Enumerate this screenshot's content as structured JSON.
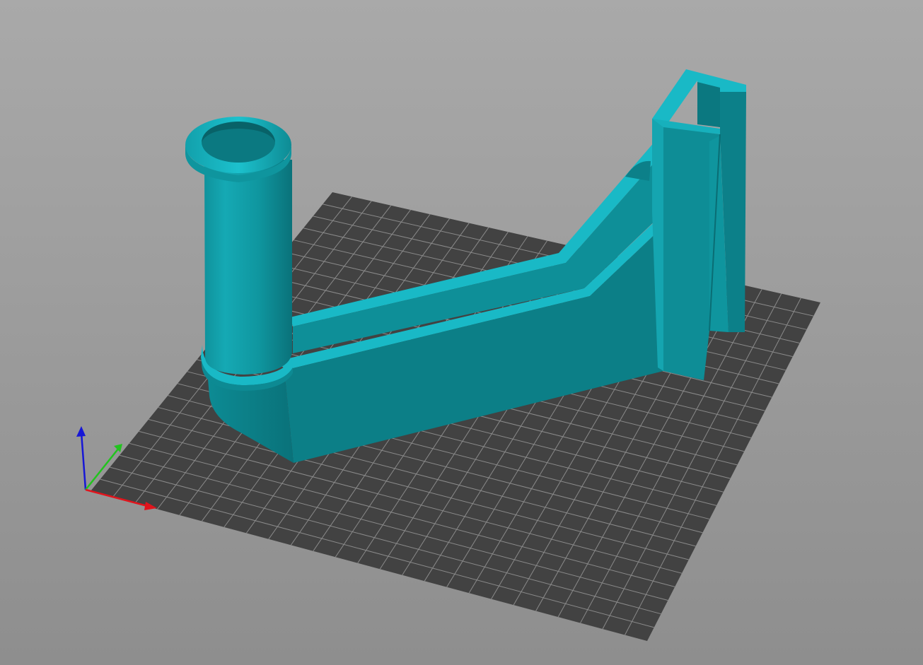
{
  "viewport": {
    "background_top": "#a9a9a9",
    "background_bottom": "#8e8e8e"
  },
  "bed": {
    "fill": "#424242",
    "grid_line": "#8a8a8a",
    "grid_divisions": 25
  },
  "model": {
    "color_light": "#19b9c6",
    "color_mid": "#109aa3",
    "color_dark": "#0b7f87",
    "color_shadow": "#0a6c73"
  },
  "axes": {
    "x_color": "#e0141c",
    "y_color": "#22c41e",
    "z_color": "#1717d6"
  }
}
